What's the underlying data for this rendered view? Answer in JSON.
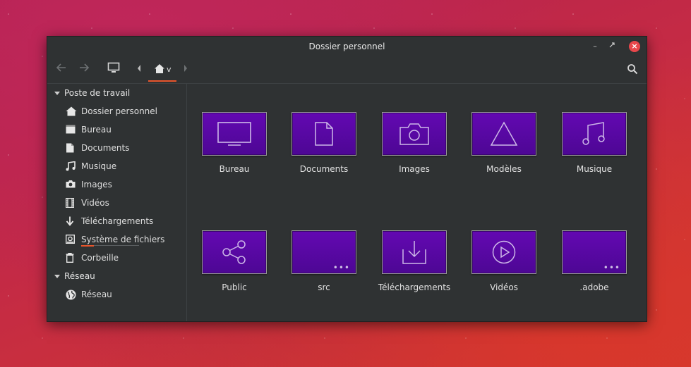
{
  "window": {
    "title": "Dossier personnel"
  },
  "breadcrumb": {
    "path_suffix": "v"
  },
  "sidebar": {
    "sections": [
      {
        "label": "Poste de travail"
      },
      {
        "label": "Réseau"
      }
    ],
    "items": [
      {
        "label": "Dossier personnel",
        "icon": "home-icon"
      },
      {
        "label": "Bureau",
        "icon": "desktop-icon"
      },
      {
        "label": "Documents",
        "icon": "document-icon"
      },
      {
        "label": "Musique",
        "icon": "music-icon"
      },
      {
        "label": "Images",
        "icon": "camera-icon"
      },
      {
        "label": "Vidéos",
        "icon": "film-icon"
      },
      {
        "label": "Téléchargements",
        "icon": "download-icon"
      },
      {
        "label": "Système de fichiers",
        "icon": "drive-icon"
      },
      {
        "label": "Corbeille",
        "icon": "trash-icon"
      },
      {
        "label": "Réseau",
        "icon": "globe-icon"
      }
    ]
  },
  "folders": [
    {
      "label": "Bureau",
      "icon": "monitor-icon"
    },
    {
      "label": "Documents",
      "icon": "document-icon"
    },
    {
      "label": "Images",
      "icon": "camera-icon"
    },
    {
      "label": "Modèles",
      "icon": "triangle-icon"
    },
    {
      "label": "Musique",
      "icon": "music-note-icon"
    },
    {
      "label": "Public",
      "icon": "share-icon"
    },
    {
      "label": "src",
      "icon": "more-dots-icon"
    },
    {
      "label": "Téléchargements",
      "icon": "download-tray-icon"
    },
    {
      "label": "Vidéos",
      "icon": "play-icon"
    },
    {
      "label": ".adobe",
      "icon": "more-dots-icon"
    }
  ],
  "colors": {
    "folder_fill": "#5a08a6",
    "accent": "#e8552c",
    "close": "#e8474b",
    "window_bg": "#2f3233"
  }
}
